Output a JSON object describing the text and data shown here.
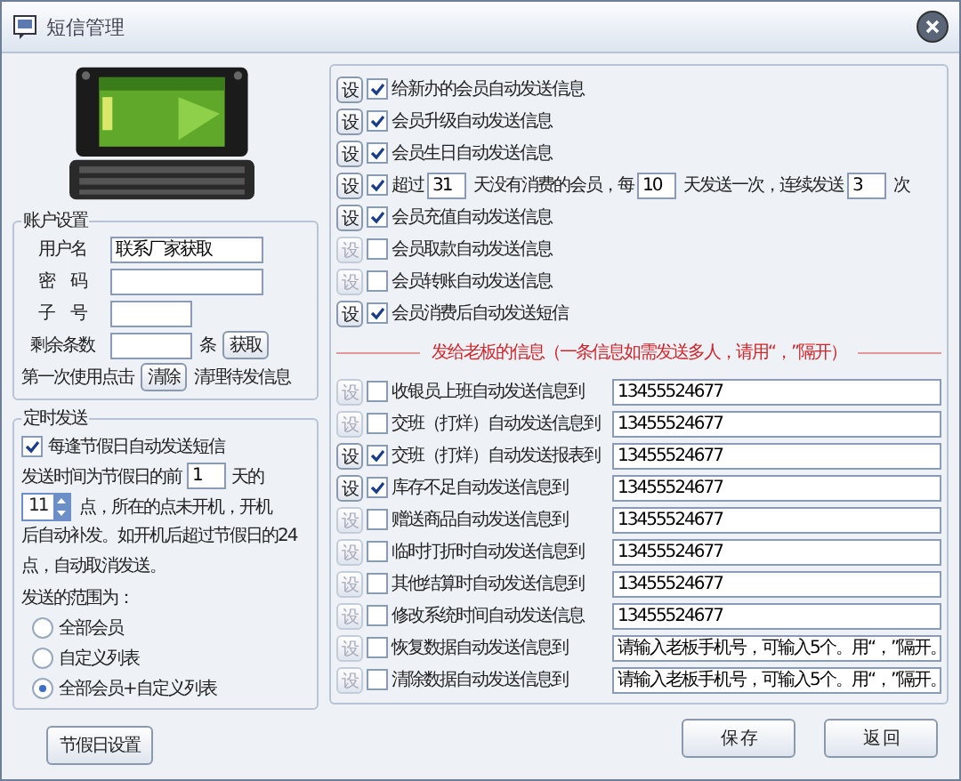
{
  "window": {
    "title": "短信管理"
  },
  "device": {
    "kind": "picture"
  },
  "account": {
    "legend": "账户设置",
    "fields": [
      {
        "label": "用户名",
        "value": "联系厂家获取",
        "kind": "long"
      },
      {
        "label": "密　码",
        "kind": "long"
      },
      {
        "label": "子　号",
        "kind": "short"
      }
    ],
    "remaining": {
      "label": "剩余条数",
      "unit": "条",
      "button": "获取"
    },
    "clear": {
      "before": "第一次使用点击",
      "button": "清除",
      "after": "清理待发信息"
    }
  },
  "timer": {
    "legend": "定时发送",
    "auto": {
      "label": "每逢节假日自动发送短信",
      "checked": true
    },
    "days_before": "发送时间为节假日的前",
    "days": "1",
    "days_unit": "天的",
    "hour": "11",
    "hour_text": "点，所在的点未开机，开机",
    "note": "后自动补发。如开机后超过节假日的24点，自动取消发送。",
    "range_label": "发送的范围为：",
    "ranges": [
      {
        "label": "全部会员",
        "selected": false
      },
      {
        "label": "自定义列表",
        "selected": false
      },
      {
        "label": "全部会员+自定义列表",
        "selected": true
      }
    ]
  },
  "holiday_button": "节假日设置",
  "member_rules": [
    {
      "kind": "simple",
      "set": "设",
      "checked": true,
      "label": "给新办的会员自动发送信息"
    },
    {
      "kind": "simple",
      "set": "设",
      "checked": true,
      "label": "会员升级自动发送信息"
    },
    {
      "kind": "simple",
      "set": "设",
      "checked": true,
      "label": "会员生日自动发送信息"
    },
    {
      "kind": "overdue",
      "set": "设",
      "checked": true,
      "parts": [
        "超过",
        "31",
        "天没有消费的会员，每",
        "10",
        "天发送一次，连续发送",
        "3",
        "次"
      ]
    },
    {
      "kind": "simple",
      "set": "设",
      "checked": true,
      "label": "会员充值自动发送信息"
    },
    {
      "kind": "simple",
      "set": "设",
      "checked": false,
      "label": "会员取款自动发送信息"
    },
    {
      "kind": "simple",
      "set": "设",
      "checked": false,
      "label": "会员转账自动发送信息"
    },
    {
      "kind": "simple",
      "set": "设",
      "checked": true,
      "label": "会员消费后自动发送短信"
    }
  ],
  "boss": {
    "heading": "发给老板的信息（一条信息如需发送多人，请用“，”隔开）",
    "rows": [
      {
        "set": "设",
        "checked": false,
        "label": "收银员上班自动发送信息到",
        "value": "13455524677"
      },
      {
        "set": "设",
        "checked": false,
        "label": "交班（打烊）自动发送信息到",
        "value": "13455524677"
      },
      {
        "set": "设",
        "checked": true,
        "label": "交班（打烊）自动发送报表到",
        "value": "13455524677"
      },
      {
        "set": "设",
        "checked": true,
        "label": "库存不足自动发送信息到",
        "value": "13455524677"
      },
      {
        "set": "设",
        "checked": false,
        "label": "赠送商品自动发送信息到",
        "value": "13455524677"
      },
      {
        "set": "设",
        "checked": false,
        "label": "临时打折时自动发送信息到",
        "value": "13455524677"
      },
      {
        "set": "设",
        "checked": false,
        "label": "其他结算时自动发送信息到",
        "value": "13455524677"
      },
      {
        "set": "设",
        "checked": false,
        "label": "修改系统时间自动发送信息",
        "value": "13455524677"
      },
      {
        "set": "设",
        "checked": false,
        "label": "恢复数据自动发送信息到",
        "value": "请输入老板手机号，可输入5个。用“，”隔开。"
      },
      {
        "set": "设",
        "checked": false,
        "label": "清除数据自动发送信息到",
        "value": "请输入老板手机号，可输入5个。用“，”隔开。"
      }
    ]
  },
  "buttons": [
    "保 存",
    "返 回"
  ]
}
